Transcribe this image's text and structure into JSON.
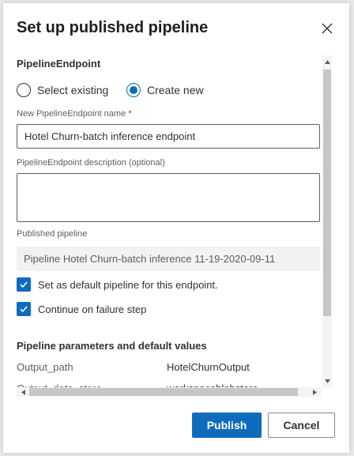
{
  "dialog": {
    "title": "Set up published pipeline",
    "close_icon": "close-icon"
  },
  "endpoint": {
    "section_title": "PipelineEndpoint",
    "radio_options": [
      {
        "label": "Select existing",
        "selected": false
      },
      {
        "label": "Create new",
        "selected": true
      }
    ],
    "name_label": "New PipelineEndpoint name",
    "required_mark": "*",
    "name_value": "Hotel Churn-batch inference endpoint",
    "description_label": "PipelineEndpoint description (optional)",
    "description_value": ""
  },
  "published": {
    "label": "Published pipeline",
    "value": "Pipeline Hotel Churn-batch inference 11-19-2020-09-11"
  },
  "checkboxes": [
    {
      "label": "Set as default pipeline for this endpoint.",
      "checked": true
    },
    {
      "label": "Continue on failure step",
      "checked": true
    }
  ],
  "parameters": {
    "section_title": "Pipeline parameters and default values",
    "rows": [
      {
        "name": "Output_path",
        "value": "HotelChurnOutput"
      },
      {
        "name": "Output_data_store",
        "value": "workspaceblobstore"
      }
    ]
  },
  "footer": {
    "publish_label": "Publish",
    "cancel_label": "Cancel"
  },
  "colors": {
    "accent": "#0f6cbd",
    "required": "#a4262c"
  }
}
